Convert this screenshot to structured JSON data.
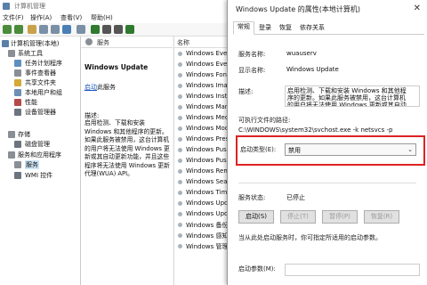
{
  "main_window": {
    "title": "计算机管理",
    "menu": [
      "文件(F)",
      "操作(A)",
      "查看(V)",
      "帮助(H)"
    ],
    "tree": [
      {
        "label": "计算机管理(本地)",
        "level": 0
      },
      {
        "label": "系统工具",
        "level": 1
      },
      {
        "label": "任务计划程序",
        "level": 2
      },
      {
        "label": "事件查看器",
        "level": 2
      },
      {
        "label": "共享文件夹",
        "level": 2
      },
      {
        "label": "本地用户和组",
        "level": 2
      },
      {
        "label": "性能",
        "level": 2
      },
      {
        "label": "设备管理器",
        "level": 2
      },
      {
        "label": "存储",
        "level": 1
      },
      {
        "label": "磁盘管理",
        "level": 2
      },
      {
        "label": "服务和应用程序",
        "level": 1
      },
      {
        "label": "服务",
        "level": 2,
        "selected": true
      },
      {
        "label": "WMI 控件",
        "level": 2
      }
    ],
    "services_header": "服务",
    "description_panel": {
      "service_name": "Windows Update",
      "start_link": "启动",
      "start_suffix": "此服务",
      "desc_label": "描述:",
      "desc_text": "启用检测、下载和安装 Windows 和其他程序的更新。如果此服务被禁用，这台计算机的用户将无法使用 Windows 更新或其自动更新功能，并且这些程序将无法使用 Windows 更新代理(WUA) API。"
    },
    "list_header": "名称",
    "services": [
      "Windows Event Co",
      "Windows Event Lo",
      "Windows Font Cac",
      "Windows Image Ac",
      "Windows Installer",
      "Windows Manage",
      "Windows Media Pl",
      "Windows Modules",
      "Windows Presentat",
      "Windows Push Not",
      "Windows PushToIn",
      "Windows Remote",
      "Windows Search",
      "Windows Time",
      "Windows Update",
      "Windows Update",
      "Windows 备份",
      "Windows 感知",
      "Windows 管理"
    ]
  },
  "dialog": {
    "title": "Windows Update 的属性(本地计算机)",
    "close": "✕",
    "tabs": [
      "常规",
      "登录",
      "恢复",
      "依存关系"
    ],
    "service_name_label": "服务名称:",
    "service_name": "wuauserv",
    "display_name_label": "显示名称:",
    "display_name": "Windows Update",
    "description_label": "描述:",
    "description": "启用检测、下载和安装 Windows 和其他程序的更新。如果此服务被禁用，这台计算机的用户将无法使用 Windows 更新或其自动更新功能，并且这些程序将无法使用",
    "path_label": "可执行文件的路径:",
    "path": "C:\\WINDOWS\\system32\\svchost.exe -k netsvcs -p",
    "startup_label": "启动类型(E):",
    "startup_value": "禁用",
    "status_label": "服务状态:",
    "status_value": "已停止",
    "buttons": [
      "启动(S)",
      "停止(T)",
      "暂停(P)",
      "恢复(R)"
    ],
    "hint": "当从此处启动服务时，你可指定所适用的启动参数。",
    "param_label": "启动参数(M):"
  }
}
